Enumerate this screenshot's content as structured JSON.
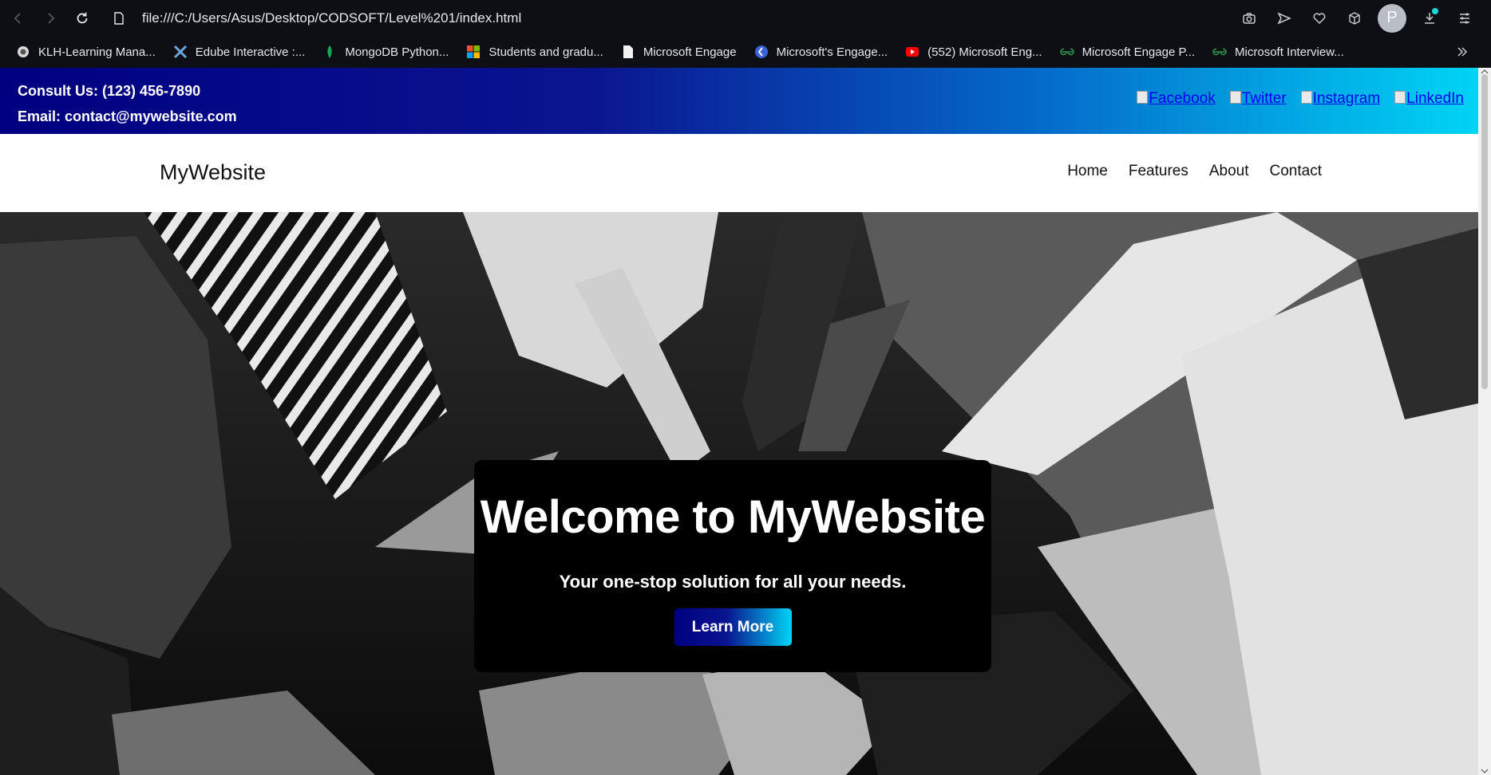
{
  "browser": {
    "url": "file:///C:/Users/Asus/Desktop/CODSOFT/Level%201/index.html",
    "profile_initial": "P",
    "bookmarks": [
      {
        "label": "KLH-Learning Mana...",
        "icon": "klh-icon"
      },
      {
        "label": "Edube Interactive :...",
        "icon": "edube-icon"
      },
      {
        "label": "MongoDB Python...",
        "icon": "mongodb-icon"
      },
      {
        "label": "Students and gradu...",
        "icon": "microsoft-icon"
      },
      {
        "label": "Microsoft Engage",
        "icon": "document-icon"
      },
      {
        "label": "Microsoft's Engage...",
        "icon": "engage-icon"
      },
      {
        "label": "(552) Microsoft Eng...",
        "icon": "youtube-icon"
      },
      {
        "label": "Microsoft Engage P...",
        "icon": "gfg-icon"
      },
      {
        "label": "Microsoft Interview...",
        "icon": "gfg-icon"
      }
    ]
  },
  "topbar": {
    "phone": "Consult Us: (123) 456-7890",
    "email": "Email: contact@mywebsite.com",
    "social": [
      "Facebook",
      "Twitter",
      "Instagram",
      "LinkedIn"
    ]
  },
  "header": {
    "logo": "MyWebsite",
    "nav": [
      "Home",
      "Features",
      "About",
      "Contact"
    ]
  },
  "hero": {
    "title": "Welcome to MyWebsite",
    "subtitle": "Your one-stop solution for all your needs.",
    "button": "Learn More"
  },
  "colors": {
    "gradient_start": "#000080",
    "gradient_end": "#00d4f5",
    "chrome_bg": "#0e0f14"
  }
}
